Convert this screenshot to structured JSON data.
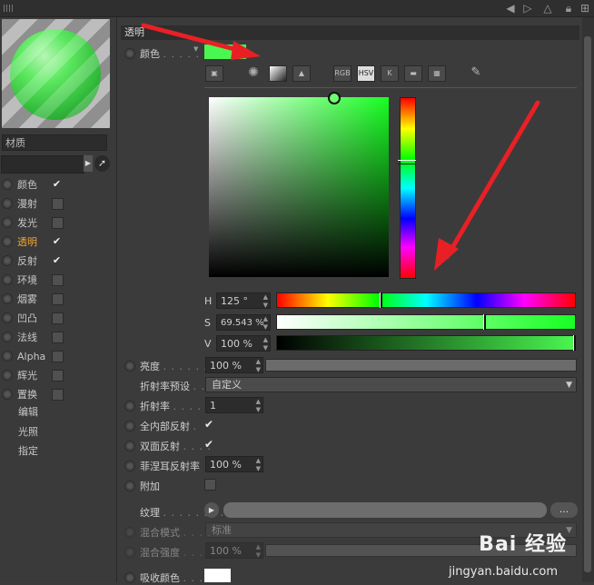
{
  "section_title": "透明",
  "material_label": "材质",
  "channels": [
    {
      "label": "颜色",
      "checked": true,
      "active": false
    },
    {
      "label": "漫射",
      "checked": false,
      "active": false
    },
    {
      "label": "发光",
      "checked": false,
      "active": false
    },
    {
      "label": "透明",
      "checked": true,
      "active": true
    },
    {
      "label": "反射",
      "checked": true,
      "active": false
    },
    {
      "label": "环境",
      "checked": false,
      "active": false
    },
    {
      "label": "烟雾",
      "checked": false,
      "active": false
    },
    {
      "label": "凹凸",
      "checked": false,
      "active": false
    },
    {
      "label": "法线",
      "checked": false,
      "active": false
    },
    {
      "label": "Alpha",
      "checked": false,
      "active": false
    },
    {
      "label": "辉光",
      "checked": false,
      "active": false
    },
    {
      "label": "置换",
      "checked": false,
      "active": false
    }
  ],
  "sub_items": [
    "编辑",
    "光照",
    "指定"
  ],
  "color": {
    "label": "颜色",
    "dots": ". . . . .",
    "value_hex": "#4af750"
  },
  "picker_tools": [
    "RGB",
    "HSV",
    "K"
  ],
  "hsv": {
    "h_label": "H",
    "h_value": "125 °",
    "s_label": "S",
    "s_value": "69.543 %",
    "v_label": "V",
    "v_value": "100 %"
  },
  "brightness": {
    "label": "亮度",
    "dots": ". . . . . . .",
    "value": "100 %"
  },
  "refraction_preset": {
    "label": "折射率预设",
    "dots": ". .",
    "value": "自定义"
  },
  "refraction": {
    "label": "折射率",
    "dots": ". . . . .",
    "value": "1"
  },
  "total_internal": {
    "label": "全内部反射",
    "dots": ".",
    "checked": true
  },
  "double_sided": {
    "label": "双面反射",
    "dots": ". . . .",
    "checked": true
  },
  "fresnel": {
    "label": "菲涅耳反射率",
    "value": "100 %"
  },
  "additive": {
    "label": "附加",
    "checked": false
  },
  "texture": {
    "label": "纹理",
    "dots": ". . . . . . . .",
    "more": "..."
  },
  "mix_mode": {
    "label": "混合模式",
    "dots": ". . . . .",
    "value": "标准"
  },
  "mix_strength": {
    "label": "混合强度",
    "dots": ". . .",
    "value": "100 %"
  },
  "absorb_color": {
    "label": "吸收颜色",
    "dots": ". . ."
  },
  "watermark": {
    "brand": "Bai 经验",
    "url": "jingyan.baidu.com"
  },
  "colors": {
    "accent_orange": "#f4a52a",
    "picked_green": "#4af750",
    "arrow_red": "#e82025"
  }
}
